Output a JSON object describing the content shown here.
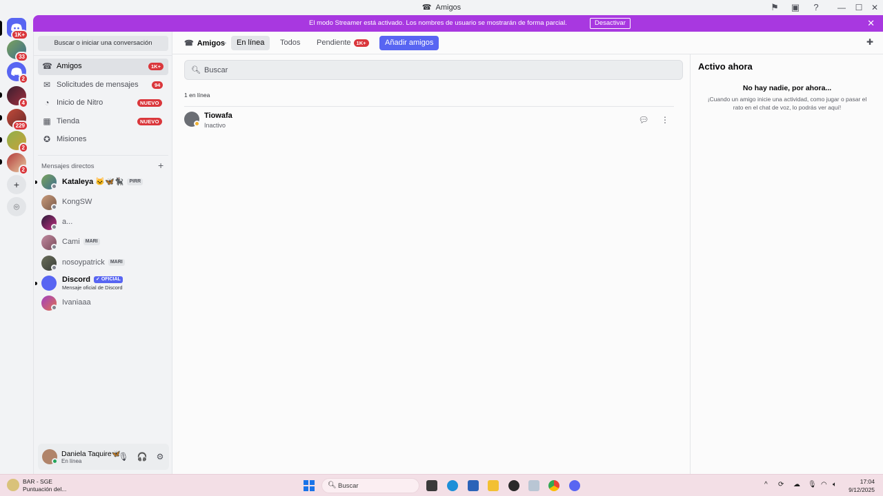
{
  "window": {
    "title": "Amigos",
    "minimize": "—",
    "maximize": "☐",
    "close": "✕"
  },
  "server_rail": {
    "items": [
      {
        "name": "home",
        "badge": "1K+"
      },
      {
        "name": "server-1",
        "badge": "33"
      },
      {
        "name": "server-2",
        "badge": "2"
      },
      {
        "name": "server-3",
        "badge": "4"
      },
      {
        "name": "server-4",
        "badge": "229"
      },
      {
        "name": "server-5",
        "badge": "2"
      },
      {
        "name": "server-6",
        "badge": "2"
      }
    ],
    "add_icon": "+",
    "explore_icon": "⌾"
  },
  "banner": {
    "text": "El modo Streamer está activado. Los nombres de usuario se mostrarán de forma parcial.",
    "button": "Desactivar",
    "close": "✕",
    "color": "#a838e0"
  },
  "dm_sidebar": {
    "search_label": "Buscar o iniciar una conversación",
    "nav": [
      {
        "label": "Amigos",
        "badge": "1K+",
        "icon": "friends-icon"
      },
      {
        "label": "Solicitudes de mensajes",
        "badge": "94",
        "icon": "inbox-icon"
      },
      {
        "label": "Inicio de Nitro",
        "badge": "NUEVO",
        "icon": "nitro-icon"
      },
      {
        "label": "Tienda",
        "badge": "NUEVO",
        "icon": "shop-icon"
      },
      {
        "label": "Misiones",
        "badge": "",
        "icon": "quest-icon"
      }
    ],
    "dm_header": "Mensajes directos",
    "dm_add": "+",
    "dms": [
      {
        "name": "Kataleya 🐱🦋🐈‍⬛",
        "tag": "PIRR",
        "sub": ""
      },
      {
        "name": "KongSW",
        "tag": "",
        "sub": ""
      },
      {
        "name": "a...",
        "tag": "",
        "sub": ""
      },
      {
        "name": "Cami",
        "tag": "MARI",
        "sub": ""
      },
      {
        "name": "nosoypatrick",
        "tag": "MARI",
        "sub": ""
      },
      {
        "name": "Discord",
        "tag": "✓ OFICIAL",
        "sub": "Mensaje oficial de Discord"
      },
      {
        "name": "Ivaniaaa",
        "tag": "",
        "sub": ""
      }
    ]
  },
  "user_panel": {
    "name": "Daniela Taquire🦋",
    "status": "En línea",
    "mic_icon": "🎙",
    "headset_icon": "🎧",
    "settings_icon": "⚙"
  },
  "topbar": {
    "title": "Amigos",
    "tabs": [
      "En línea",
      "Todos",
      "Pendiente"
    ],
    "pending_badge": "1K+",
    "add_friend": "Añadir amigos"
  },
  "friends": {
    "search_placeholder": "Buscar",
    "count_label": "1 en línea",
    "list": [
      {
        "name": "Tiowafa",
        "status": "Inactivo"
      }
    ]
  },
  "activity": {
    "title": "Activo ahora",
    "empty_title": "No hay nadie, por ahora...",
    "empty_desc": "¡Cuando un amigo inicie una actividad, como jugar o pasar el rato en el chat de voz, lo podrás ver aquí!"
  },
  "taskbar": {
    "weather_line1": "BAR - SGE",
    "weather_line2": "Puntuación del...",
    "search_label": "Buscar",
    "time": "17:04",
    "date": "9/12/2025"
  },
  "colors": {
    "accent": "#5865f2",
    "danger": "#da373c",
    "online": "#23a55a",
    "idle": "#f0b232"
  }
}
